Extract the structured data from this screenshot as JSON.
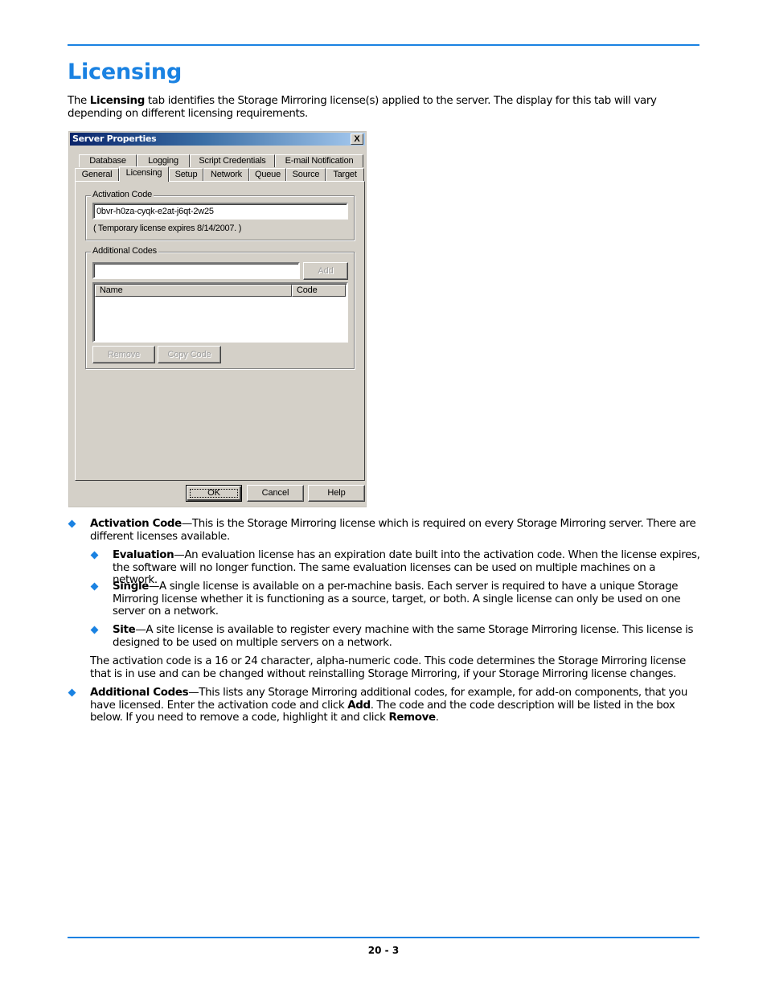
{
  "page": {
    "title": "Licensing",
    "intro": {
      "pre": "The ",
      "bold": "Licensing",
      "post": " tab identifies the Storage Mirroring license(s) applied to the server. The display for this tab will vary depending on different licensing requirements."
    },
    "page_number": "20 - 3",
    "accent_color": "#1a82e2"
  },
  "dialog": {
    "title": "Server Properties",
    "close_label": "X",
    "tabs_row1": [
      "Database",
      "Logging",
      "Script Credentials",
      "E-mail Notification"
    ],
    "tabs_row2": [
      "General",
      "Licensing",
      "Setup",
      "Network",
      "Queue",
      "Source",
      "Target"
    ],
    "active_tab": "Licensing",
    "activation_group": {
      "label": "Activation Code",
      "value": "0bvr-h0za-cyqk-e2at-j6qt-2w25",
      "note": "( Temporary license expires 8/14/2007. )"
    },
    "additional_group": {
      "label": "Additional Codes",
      "input_value": "",
      "add_label": "Add",
      "columns": [
        "Name",
        "Code"
      ],
      "rows": [],
      "remove_label": "Remove",
      "copy_label": "Copy Code"
    },
    "buttons": {
      "ok": "OK",
      "cancel": "Cancel",
      "help": "Help"
    }
  },
  "bullets": {
    "activation": {
      "term": "Activation Code",
      "text": "—This is the Storage Mirroring license which is required on every Storage Mirroring server. There are different licenses available."
    },
    "evaluation": {
      "term": "Evaluation",
      "text": "—An evaluation license has an expiration date built into the activation code. When the license expires, the software will no longer function. The same evaluation licenses can be used on multiple machines on a network."
    },
    "single": {
      "term": "Single",
      "text": "—A single license is available on a per-machine basis. Each server is required to have a unique Storage Mirroring license whether it is functioning as a source, target, or both. A single license can only be used on one server on a network."
    },
    "site": {
      "term": "Site",
      "text": "—A site license is available to register every machine with the same Storage Mirroring license. This license is designed to be used on multiple servers on a network."
    },
    "activation_note": "The activation code is a 16 or 24 character, alpha-numeric code. This code determines the Storage Mirroring license that is in use and can be changed without reinstalling Storage Mirroring, if your Storage Mirroring license changes.",
    "additional": {
      "term": "Additional Codes",
      "text1": "—This lists any Storage Mirroring additional codes, for example, for add-on components, that you have licensed. Enter the activation code and click ",
      "bold1": "Add",
      "text2": ". The code and the code description will be listed in the box below. If you need to remove a code, highlight it and click ",
      "bold2": "Remove",
      "text3": "."
    }
  }
}
